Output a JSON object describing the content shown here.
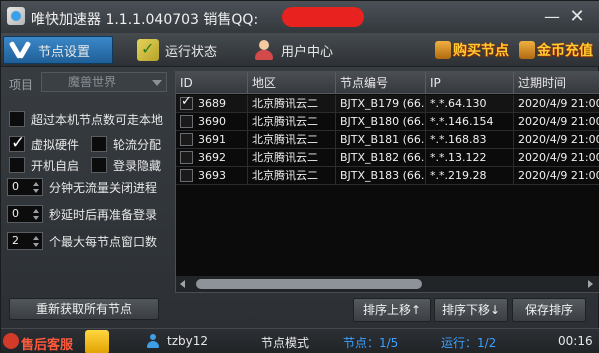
{
  "window": {
    "title": "唯快加速器 1.1.1.040703 销售QQ:",
    "minimize_symbol": "—",
    "close_symbol": "✕"
  },
  "toolbar": {
    "tabs": [
      {
        "label": "节点设置",
        "icon": "tools-icon",
        "active": true
      },
      {
        "label": "运行状态",
        "icon": "status-check-icon",
        "active": false
      },
      {
        "label": "用户中心",
        "icon": "user-icon",
        "active": false
      }
    ],
    "buy_label": "购买节点",
    "recharge_label": "金币充值"
  },
  "left_panel": {
    "project_label": "项目",
    "project_value": "魔兽世界",
    "checkboxes": {
      "exceed_local": {
        "label": "超过本机节点数可走本地",
        "checked": false
      },
      "virtual_hw": {
        "label": "虚拟硬件",
        "checked": true
      },
      "round_robin": {
        "label": "轮流分配",
        "checked": false
      },
      "auto_start": {
        "label": "开机自启",
        "checked": false
      },
      "login_hide": {
        "label": "登录隐藏",
        "checked": false
      }
    },
    "spinners": {
      "idle_close": {
        "value": "0",
        "label": "分钟无流量关闭进程"
      },
      "delay_login": {
        "value": "0",
        "label": "秒延时后再准备登录"
      },
      "max_windows": {
        "value": "2",
        "label": "个最大每节点窗口数"
      }
    },
    "refresh_button": "重新获取所有节点"
  },
  "table": {
    "columns": [
      "ID",
      "地区",
      "节点编号",
      "IP",
      "过期时间"
    ],
    "rows": [
      {
        "checked": true,
        "id": "3689",
        "region": "北京腾讯云二",
        "node": "BJTX_B179 (66...",
        "ip": "*.*.64.130",
        "expiry": "2020/4/9 21:00"
      },
      {
        "checked": false,
        "id": "3690",
        "region": "北京腾讯云二",
        "node": "BJTX_B180 (66...",
        "ip": "*.*.146.154",
        "expiry": "2020/4/9 21:00"
      },
      {
        "checked": false,
        "id": "3691",
        "region": "北京腾讯云二",
        "node": "BJTX_B181 (66...",
        "ip": "*.*.168.83",
        "expiry": "2020/4/9 21:00"
      },
      {
        "checked": false,
        "id": "3692",
        "region": "北京腾讯云二",
        "node": "BJTX_B182 (66...",
        "ip": "*.*.13.122",
        "expiry": "2020/4/9 21:00"
      },
      {
        "checked": false,
        "id": "3693",
        "region": "北京腾讯云二",
        "node": "BJTX_B183 (66...",
        "ip": "*.*.219.28",
        "expiry": "2020/4/9 21:00"
      }
    ],
    "buttons": {
      "move_up": "排序上移↑",
      "move_down": "排序下移↓",
      "save": "保存排序"
    }
  },
  "statusbar": {
    "service": "售后客服",
    "user": "tzby12",
    "mode": "节点模式",
    "node": "节点：1/5",
    "running": "运行：1/2",
    "time": "00:16"
  },
  "colors": {
    "accent": "#2f7fc1",
    "status_blue": "#3ba0ff",
    "promo_gold": "#ffcc33",
    "service_red": "#ff5a3c"
  }
}
